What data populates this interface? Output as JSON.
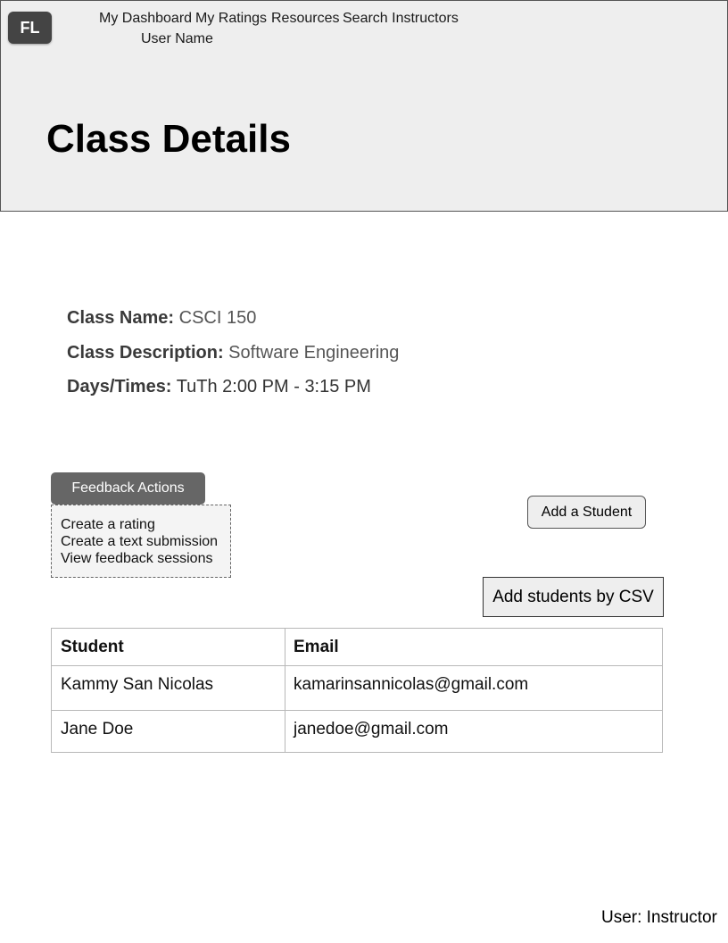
{
  "nav": {
    "logo": "FL",
    "links": [
      "My Dashboard",
      "My Ratings",
      "Resources",
      "Search Instructors"
    ],
    "user_menu": "User Name ",
    "user_menu_icon": "chevron-down-icon"
  },
  "header": {
    "title": "Class Details"
  },
  "class_info": {
    "name_label": "Class Name:",
    "name_value": "CSCI 150",
    "description_label": "Class Description:",
    "description_value": "Software Engineering",
    "days_label": "Days/Times:",
    "days_value": "TuTh 2:00 PM - 3:15 PM"
  },
  "feedback_actions": {
    "label": "Feedback Actions ",
    "icon": "chevron-down-icon",
    "items": [
      "Create a rating",
      "Create a text submission",
      "View feedback sessions"
    ]
  },
  "buttons": {
    "add_student": "Add a Student",
    "add_csv": "Add students by CSV"
  },
  "table": {
    "headers": [
      "Student ",
      "Email "
    ],
    "sort_icon": "sort-icon",
    "rows": [
      [
        "Kammy San Nicolas",
        "kamarinsannicolas@gmail.com"
      ],
      [
        "Jane Doe",
        "janedoe@gmail.com"
      ]
    ]
  },
  "footer": {
    "role": "User: Instructor"
  },
  "colors": {
    "nav_background": "#eeeeee",
    "logo_background": "#444444",
    "feedback_button": "#666666",
    "menu_background": "#f4f4f4",
    "table_border": "#b8b8b8"
  }
}
